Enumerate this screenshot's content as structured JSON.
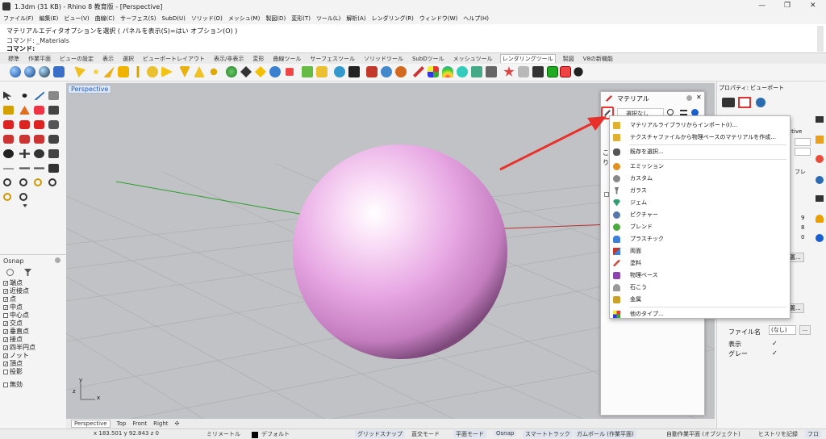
{
  "window": {
    "title": "1.3dm (31 KB) - Rhino 8 教育版 - [Perspective]",
    "minimize": "—",
    "maximize": "❐",
    "close": "✕"
  },
  "menu": [
    "ファイル(F)",
    "編集(E)",
    "ビュー(V)",
    "曲線(C)",
    "サーフェス(S)",
    "SubD(U)",
    "ソリッド(O)",
    "メッシュ(M)",
    "製図(D)",
    "変形(T)",
    "ツール(L)",
    "解析(A)",
    "レンダリング(R)",
    "ウィンドウ(W)",
    "ヘルプ(H)"
  ],
  "command": {
    "line1": "マテリアルエディタオプションを選択 ( パネルを表示(S)=はい  オプション(O) )",
    "line2": "コマンド: _Materials",
    "prompt": "コマンド:"
  },
  "toolbar_tabs": [
    "標準",
    "作業平面",
    "ビューの設定",
    "表示",
    "選択",
    "ビューポートレイアウト",
    "表示/非表示",
    "変形",
    "曲線ツール",
    "サーフェスツール",
    "ソリッドツール",
    "SubDツール",
    "メッシュツール",
    "レンダリングツール",
    "製図",
    "V8の新機能"
  ],
  "active_tab": "レンダリングツール",
  "viewport": {
    "label": "Perspective",
    "tabs": [
      "Perspective",
      "Top",
      "Front",
      "Right"
    ],
    "add_tab": "✣",
    "axis_x": "x",
    "axis_y": "y",
    "axis_z": "z"
  },
  "osnap": {
    "title": "Osnap",
    "items": [
      {
        "label": "端点",
        "checked": true
      },
      {
        "label": "近接点",
        "checked": true
      },
      {
        "label": "点",
        "checked": true
      },
      {
        "label": "中点",
        "checked": true
      },
      {
        "label": "中心点",
        "checked": false
      },
      {
        "label": "交点",
        "checked": true
      },
      {
        "label": "垂直点",
        "checked": true
      },
      {
        "label": "接点",
        "checked": true
      },
      {
        "label": "四半円点",
        "checked": true
      },
      {
        "label": "ノット",
        "checked": true
      },
      {
        "label": "頂点",
        "checked": true
      },
      {
        "label": "投影",
        "checked": false
      },
      {
        "label": "無効",
        "checked": false
      }
    ]
  },
  "material_panel": {
    "title": "マテリアル",
    "filter": "選択なし",
    "side_char1": "こ",
    "side_char2": "り"
  },
  "popup": {
    "items": [
      {
        "label": "マテリアルライブラリからインポート(I)...",
        "icon": "folder-icon",
        "color": "#e0b030"
      },
      {
        "label": "テクスチャファイルから物理ベースのマテリアルを作成...",
        "icon": "folder-open-icon",
        "color": "#e0b030"
      },
      {
        "label": "既存を選択...",
        "icon": "hand-icon",
        "color": "#555555"
      },
      {
        "label": "エミッション",
        "icon": "emission-icon",
        "color": "#e09020"
      },
      {
        "label": "カスタム",
        "icon": "custom-icon",
        "color": "#888888"
      },
      {
        "label": "ガラス",
        "icon": "glass-icon",
        "color": "#7a7a7a"
      },
      {
        "label": "ジェム",
        "icon": "gem-icon",
        "color": "#2f9f6f"
      },
      {
        "label": "ピクチャー",
        "icon": "picture-icon",
        "color": "#5577aa"
      },
      {
        "label": "ブレンド",
        "icon": "blend-icon",
        "color": "#4caa3c"
      },
      {
        "label": "プラスチック",
        "icon": "plastic-icon",
        "color": "#3d7fd9"
      },
      {
        "label": "両面",
        "icon": "two-sided-icon",
        "color": "#c0392b"
      },
      {
        "label": "塗料",
        "icon": "paint-icon",
        "color": "#d04a3a"
      },
      {
        "label": "物理ベース",
        "icon": "pbr-icon",
        "color": "#8e44ad"
      },
      {
        "label": "石こう",
        "icon": "plaster-icon",
        "color": "#999999"
      },
      {
        "label": "金属",
        "icon": "metal-icon",
        "color": "#c9a227"
      },
      {
        "label": "他のタイプ...",
        "icon": "more-types-icon",
        "color": "#555555"
      }
    ]
  },
  "right_panel": {
    "title": "プロパティ: ビューポート",
    "frag1": "ective",
    "frag2": "フレ",
    "frag3": "置...",
    "frag4": "置...",
    "nums": [
      "9",
      "8",
      "0"
    ],
    "file_label": "ファイル名",
    "file_value": "(なし)",
    "file_btn": "...",
    "show_label": "表示",
    "gray_label": "グレー",
    "check": "✓"
  },
  "status": {
    "coords": "x 183.501  y 92.843  z 0",
    "units": "ミリメートル",
    "layer": "デフォルト",
    "buttons": [
      "グリッドスナップ",
      "直交モード",
      "平面モード",
      "Osnap",
      "スマートトラック",
      "ガムボール (作業平面)",
      "自動作業平面 (オブジェクト)",
      "ヒストリを記録",
      "フロ"
    ]
  },
  "colors": {
    "accent": "#1a5fd0",
    "sphere": "#e7a7e3",
    "arrow": "#e8312a",
    "highlight": "#e33"
  }
}
